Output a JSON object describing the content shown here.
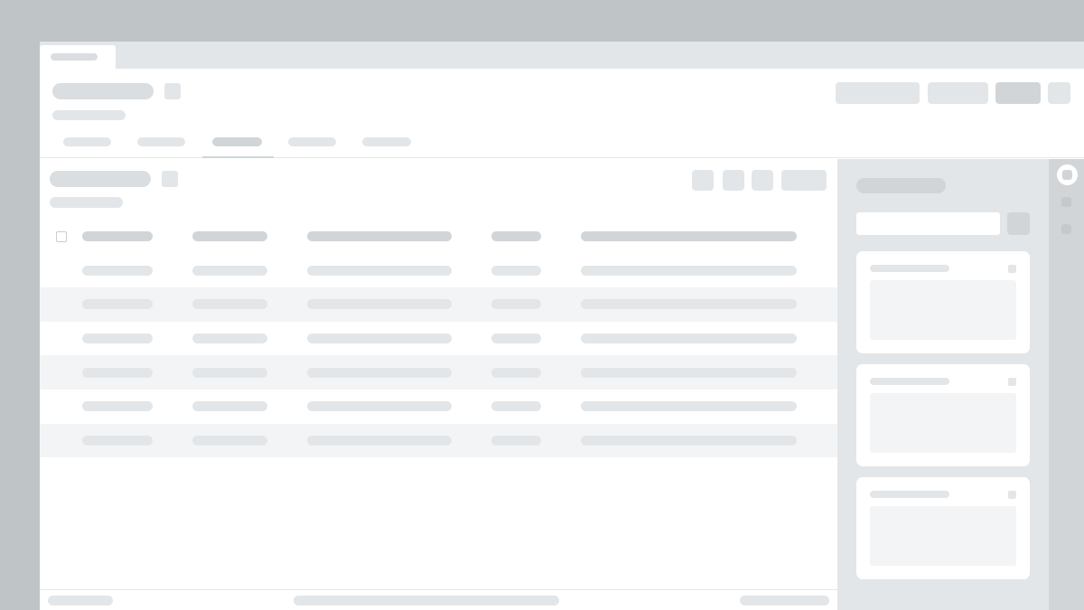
{
  "window": {
    "title": ""
  },
  "header": {
    "title": "",
    "subtitle": "",
    "buttons": [
      "",
      "",
      "",
      ""
    ],
    "tabs": [
      "",
      "",
      "",
      "",
      ""
    ],
    "active_tab_index": 2
  },
  "main": {
    "section_title": "",
    "section_subtitle": "",
    "toolbar_buttons": [
      "",
      "",
      "",
      ""
    ],
    "table": {
      "columns": [
        "",
        "",
        "",
        "",
        ""
      ],
      "rows": [
        [
          "",
          "",
          "",
          "",
          ""
        ],
        [
          "",
          "",
          "",
          "",
          ""
        ],
        [
          "",
          "",
          "",
          "",
          ""
        ],
        [
          "",
          "",
          "",
          "",
          ""
        ],
        [
          "",
          "",
          "",
          "",
          ""
        ],
        [
          "",
          "",
          "",
          "",
          ""
        ]
      ]
    },
    "footer": {
      "left": "",
      "center": "",
      "right": ""
    }
  },
  "side_panel": {
    "title": "",
    "search_placeholder": "",
    "cards": [
      {
        "title": ""
      },
      {
        "title": ""
      },
      {
        "title": ""
      }
    ]
  },
  "colors": {
    "desktop": "#bfc4c7",
    "skeleton_dark": "#d1d5d8",
    "skeleton_light": "#e3e6e8",
    "row_stripe": "#f3f4f5",
    "panel_background": "#e3e6e8",
    "surface": "#ffffff"
  },
  "icons": [
    "tab-icon",
    "rail-panel-icon",
    "rail-item-icon"
  ]
}
